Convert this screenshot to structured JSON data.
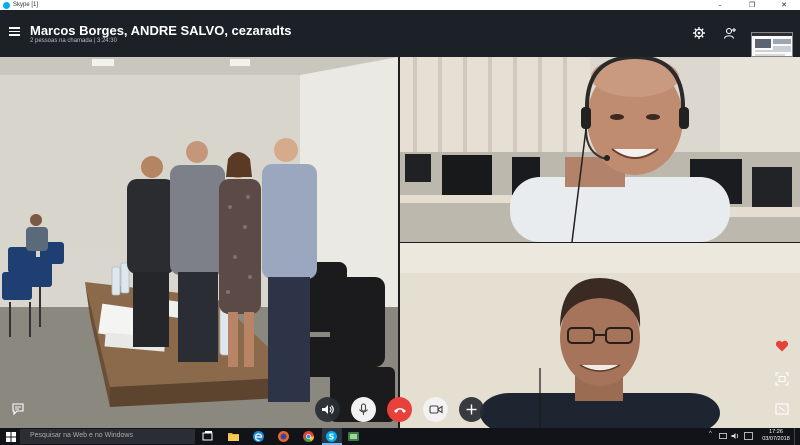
{
  "window": {
    "title": "Skype [1]",
    "minimize": "–",
    "maximize": "❐",
    "close": "✕"
  },
  "call": {
    "participants": "Marcos Borges, ANDRE SALVO, cezaradts",
    "status": "2 pessoas na chamada | 3:24:30"
  },
  "taskbar": {
    "search_placeholder": "Pesquisar na Web e no Windows",
    "time": "17:26",
    "date": "03/07/2018"
  },
  "colors": {
    "header_bg": "#1c2128",
    "hangup": "#e8413b",
    "heart": "#e8413b",
    "taskbar_bg": "#111318"
  },
  "icons": {
    "header": [
      "settings-gear-icon",
      "add-person-icon"
    ],
    "controls": [
      "speaker-icon",
      "microphone-icon",
      "hang-up-icon",
      "video-camera-icon",
      "plus-icon"
    ],
    "side": [
      "heart-icon",
      "screen-share-icon",
      "chat-icon",
      "expand-icon"
    ]
  }
}
